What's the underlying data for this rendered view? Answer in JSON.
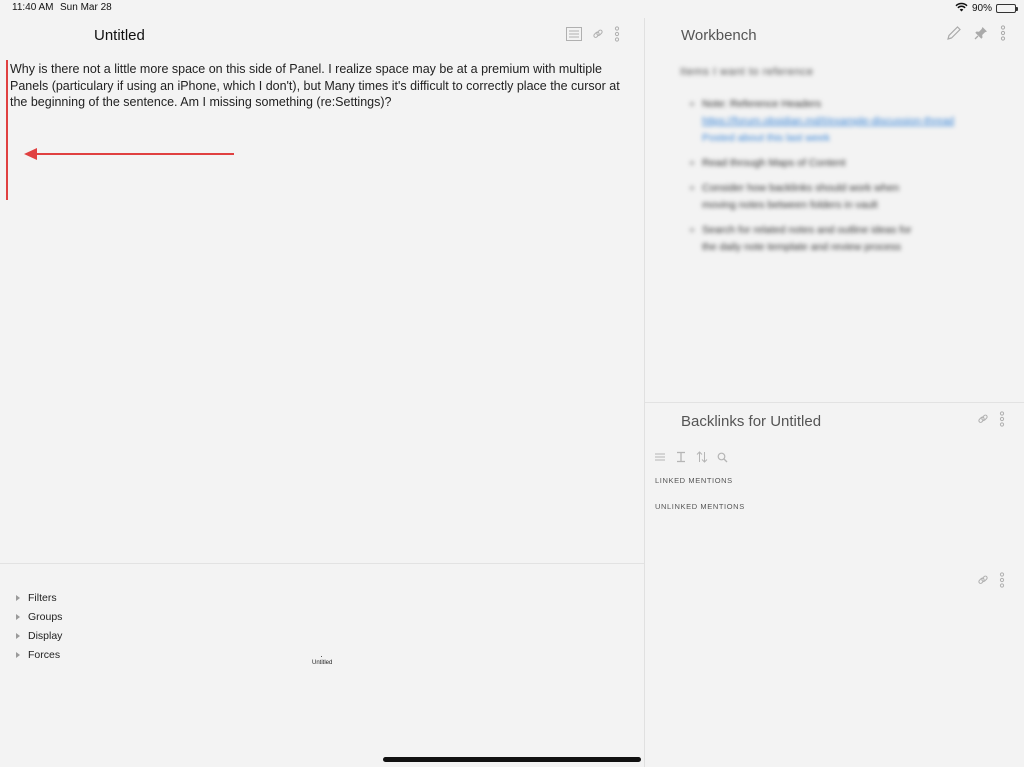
{
  "status_bar": {
    "time": "11:40 AM",
    "date": "Sun Mar 28",
    "battery": "90%",
    "battery_level": 0.9,
    "icons": [
      "wifi-icon",
      "battery-icon"
    ]
  },
  "editor": {
    "title": "Untitled",
    "body": "Why is there not a little more space on this side of Panel. I realize space may be at a premium with multiple Panels (particulary if using an iPhone, which I don't), but Many times it's difficult to correctly place the cursor at the beginning of the sentence. Am I missing something (re:Settings)?",
    "toolbar_icons": [
      "document-icon",
      "link-icon",
      "more-vertical-icon"
    ],
    "annotation_color": "#e04040"
  },
  "graph_settings": {
    "items": [
      {
        "label": "Filters"
      },
      {
        "label": "Groups"
      },
      {
        "label": "Display"
      },
      {
        "label": "Forces"
      }
    ],
    "node_label": "Untitled"
  },
  "workbench": {
    "title": "Workbench",
    "toolbar_icons": [
      "pencil-icon",
      "pin-icon",
      "more-vertical-icon"
    ],
    "heading": "Items I want to reference",
    "items": [
      {
        "text": "Note: Reference Headers",
        "link": "https://forum.obsidian.md/t/example-discussion-thread",
        "extra": "Posted about this last week"
      },
      {
        "text": "Read through Maps of Content"
      },
      {
        "text": "Consider how backlinks should work when",
        "extra": "moving notes between folders in vault"
      },
      {
        "text": "Search for related notes and outline ideas for",
        "extra": "the daily note template and review process"
      }
    ]
  },
  "backlinks": {
    "title": "Backlinks for Untitled",
    "toolbar_icons": [
      "link-icon",
      "more-vertical-icon"
    ],
    "tool_icons": [
      "collapse-icon",
      "text-cursor-icon",
      "sort-icon",
      "search-icon"
    ],
    "linked_mentions": "LINKED MENTIONS",
    "unlinked_mentions": "UNLINKED MENTIONS"
  },
  "bottom_right": {
    "toolbar_icons": [
      "link-icon",
      "more-vertical-icon"
    ]
  }
}
